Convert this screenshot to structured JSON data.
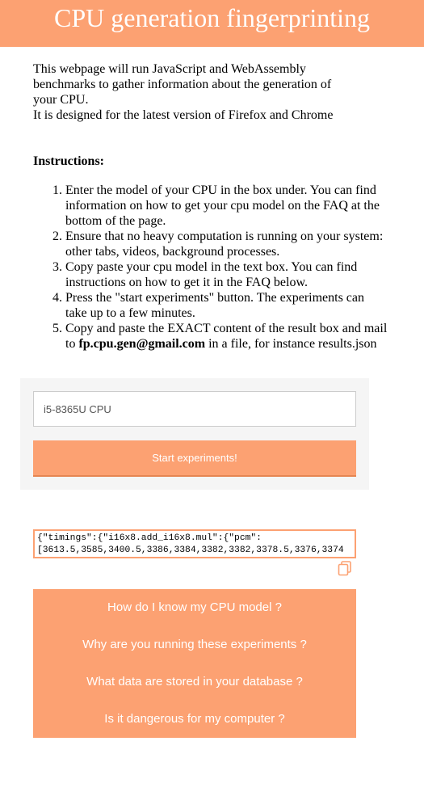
{
  "page": {
    "title": "CPU generation fingerprinting",
    "intro": [
      "This webpage will run JavaScript and WebAssembly benchmarks to gather information about the generation of your CPU.",
      "It is designed for the latest version of Firefox and Chrome"
    ],
    "instructions_heading": "Instructions:",
    "steps": [
      "Enter the model of your CPU in the box under. You can find information on how to get your cpu model on the FAQ at the bottom of the page.",
      "Ensure that no heavy computation is running on your system: other tabs, videos, background processes.",
      "Copy paste your cpu model in the text box. You can find instructions on how to get it in the FAQ below.",
      "Press the \"start experiments\" button. The experiments can take up to a few minutes."
    ],
    "step5": {
      "before": "Copy and paste the EXACT content of the result box and mail to ",
      "email": "fp.cpu.gen@gmail.com",
      "after": " in a file, for instance results.json"
    }
  },
  "form": {
    "cpu_value": "i5-8365U CPU",
    "start_label": "Start experiments!"
  },
  "result": {
    "text": "{\"timings\":{\"i16x8.add_i16x8.mul\":{\"pcm\":\n[3613.5,3585,3400.5,3386,3384,3382,3382,3378.5,3376,3374"
  },
  "icons": {
    "copy": "copy-icon"
  },
  "faq": [
    "How do I know my CPU model ?",
    "Why are you running these experiments ?",
    "What data are stored in your database ?",
    "Is it dangerous for my computer ?"
  ],
  "colors": {
    "accent": "#fca172",
    "panel": "#f5f5f5"
  }
}
